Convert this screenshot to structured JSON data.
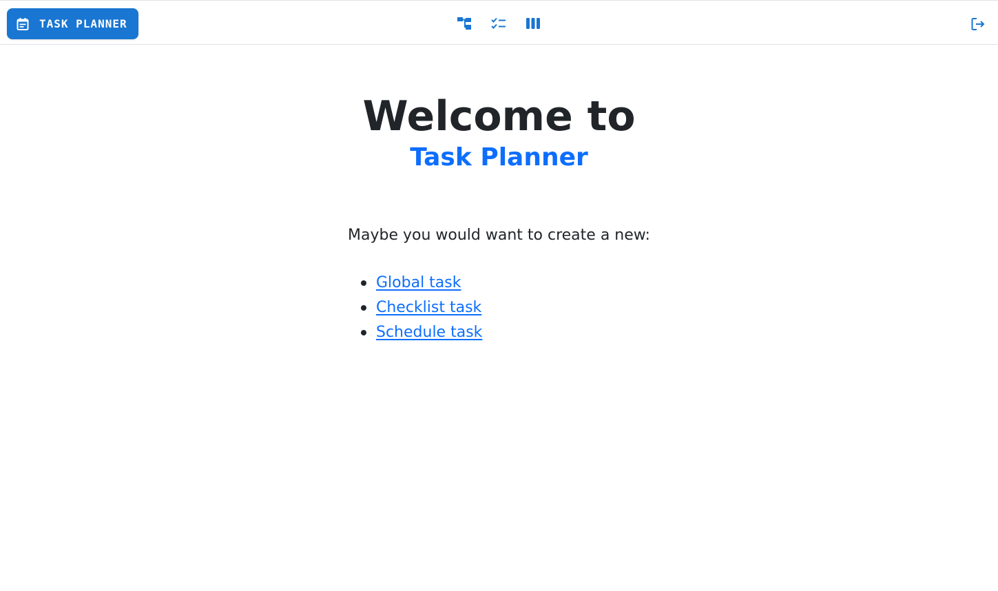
{
  "header": {
    "brand_label": "TASK PLANNER",
    "brand_icon": "calendar-icon",
    "nav_icons": [
      "hierarchy-icon",
      "checklist-icon",
      "columns-icon"
    ],
    "logout_icon": "logout-icon"
  },
  "main": {
    "title": "Welcome to",
    "subtitle": "Task Planner",
    "intro": "Maybe you would want to create a new:",
    "links": [
      {
        "label": "Global task"
      },
      {
        "label": "Checklist task"
      },
      {
        "label": "Schedule task"
      }
    ]
  },
  "colors": {
    "brand": "#1976d2",
    "link": "#0d6efd",
    "text": "#212529"
  }
}
